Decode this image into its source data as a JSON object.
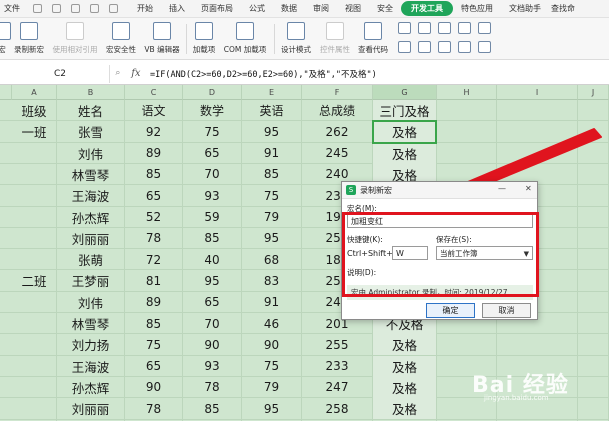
{
  "menubar": {
    "file": "文件",
    "tabs": [
      "开始",
      "插入",
      "页面布局",
      "公式",
      "数据",
      "审阅",
      "视图",
      "安全",
      "开发工具",
      "特色应用",
      "文档助手"
    ],
    "active_tab": "开发工具",
    "search_fragment": "查找命"
  },
  "ribbon": {
    "buttons": [
      {
        "label": "宏",
        "enabled": true
      },
      {
        "label": "录制新宏",
        "enabled": true
      },
      {
        "label": "使用相对引用",
        "enabled": false
      },
      {
        "label": "宏安全性",
        "enabled": true
      },
      {
        "label": "VB 编辑器",
        "enabled": true
      },
      {
        "label": "加载项",
        "enabled": true
      },
      {
        "label": "COM 加载项",
        "enabled": true
      },
      {
        "label": "设计模式",
        "enabled": true
      },
      {
        "label": "控件属性",
        "enabled": false
      },
      {
        "label": "查看代码",
        "enabled": true
      }
    ]
  },
  "formula_bar": {
    "cell_ref": "C2",
    "fx": "fx",
    "formula": "=IF(AND(C2>=60,D2>=60,E2>=60),\"及格\",\"不及格\")"
  },
  "sheet": {
    "columns": [
      "A",
      "B",
      "C",
      "D",
      "E",
      "F",
      "G",
      "H",
      "I",
      "J"
    ],
    "selected_column": "G",
    "header_row": [
      "班级",
      "姓名",
      "语文",
      "数学",
      "英语",
      "总成绩",
      "三门及格"
    ],
    "rows": [
      [
        "一班",
        "张雪",
        "92",
        "75",
        "95",
        "262",
        "及格"
      ],
      [
        "",
        "刘伟",
        "89",
        "65",
        "91",
        "245",
        "及格"
      ],
      [
        "",
        "林雪琴",
        "85",
        "70",
        "85",
        "240",
        "及格"
      ],
      [
        "",
        "王海波",
        "65",
        "93",
        "75",
        "233",
        ""
      ],
      [
        "",
        "孙杰辉",
        "52",
        "59",
        "79",
        "190",
        ""
      ],
      [
        "",
        "刘丽丽",
        "78",
        "85",
        "95",
        "258",
        ""
      ],
      [
        "",
        "张萌",
        "72",
        "40",
        "68",
        "180",
        ""
      ],
      [
        "二班",
        "王梦丽",
        "81",
        "95",
        "83",
        "259",
        ""
      ],
      [
        "",
        "刘伟",
        "89",
        "65",
        "91",
        "245",
        ""
      ],
      [
        "",
        "林雪琴",
        "85",
        "70",
        "46",
        "201",
        "不及格"
      ],
      [
        "",
        "刘力扬",
        "75",
        "90",
        "90",
        "255",
        "及格"
      ],
      [
        "",
        "王海波",
        "65",
        "93",
        "75",
        "233",
        "及格"
      ],
      [
        "",
        "孙杰辉",
        "90",
        "78",
        "79",
        "247",
        "及格"
      ],
      [
        "",
        "刘丽丽",
        "78",
        "85",
        "95",
        "258",
        "及格"
      ]
    ]
  },
  "dialog": {
    "title": "录制新宏",
    "macro_name_label": "宏名(M):",
    "macro_name_value": "加粗变红",
    "shortcut_label": "快捷键(K):",
    "shortcut_prefix": "Ctrl+Shift+",
    "shortcut_key": "W",
    "store_label": "保存在(S):",
    "store_value": "当前工作簿",
    "desc_label": "说明(D):",
    "desc_value": "宏由 Administrator 录制，时间: 2019/12/27",
    "ok_label": "确定",
    "cancel_label": "取消"
  },
  "watermark": {
    "text": "Bai 经验",
    "sub": "jingyan.baidu.com"
  },
  "colors": {
    "sheet_bg": "#cfe6cf",
    "accent": "#1fa55a",
    "highlight_red": "#e0141e"
  }
}
